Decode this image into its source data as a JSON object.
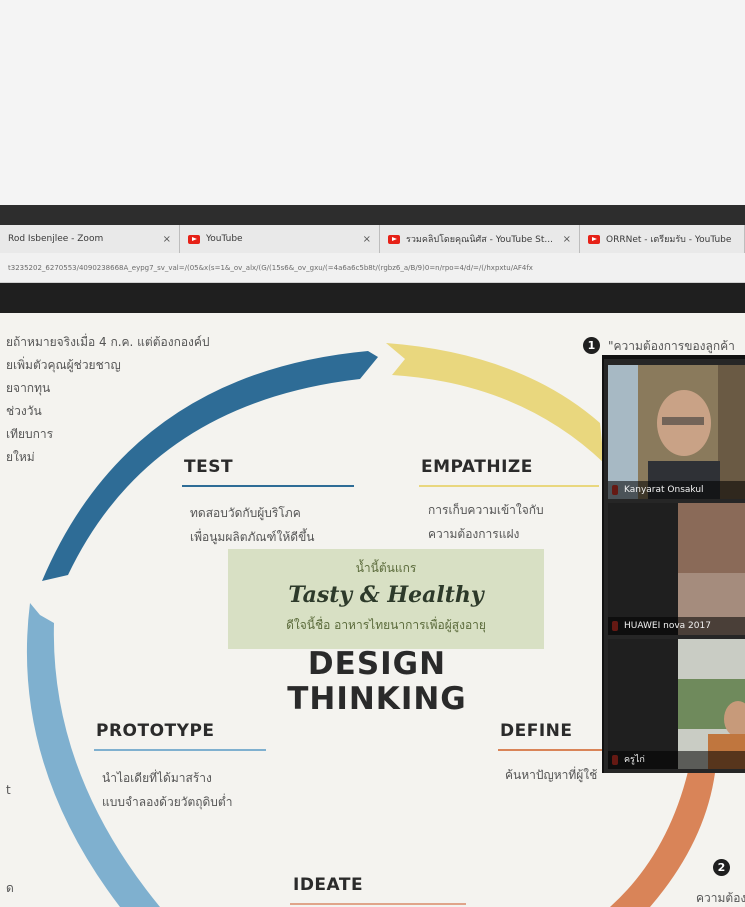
{
  "browser": {
    "tabs": [
      {
        "label": "Rod Isbenjlee - Zoom",
        "icon": "none"
      },
      {
        "label": "YouTube",
        "icon": "youtube-icon"
      },
      {
        "label": "รวมคลิปโดยคุณนิศัส - YouTube St...",
        "icon": "youtube-icon"
      },
      {
        "label": "ORRNet - เตรียมรับ - YouTube",
        "icon": "youtube-icon"
      }
    ],
    "close_glyph": "×",
    "url": "t3235202_6270553/4090238668A_eypg7_sv_val=/(05&x(s=1&_ov_alx/(G/(15s6&_ov_gxu/(=4a6a6c5b8t/(rgbz6_a/B/9)0=n/rpo=4/d/=/(/hxpxtu/AF4fx"
  },
  "slide": {
    "left_text": [
      "ยถ้าหมายจริงเมื่อ 4 ก.ค. แต่ต้องกองค์ป",
      "ยเพิ่มตัวคุณผู้ช่วยชาญ",
      "ยจากทุน",
      "ช่วงวัน",
      "เทียบการ",
      "ยใหม่"
    ],
    "phases": {
      "test": "TEST",
      "empathize": "EMPATHIZE",
      "prototype": "PROTOTYPE",
      "define": "DEFINE",
      "ideate": "IDEATE"
    },
    "test_desc": [
      "ทดสอบวัดกับผู้บริโภค",
      "เพื่อนูมผลิตภัณฑ์ให้ดีขึ้น"
    ],
    "empathize_desc": [
      "การเก็บความเข้าใจกับ",
      "ความต้องการแฝง"
    ],
    "prototype_desc": [
      "นำไอเดียที่ได้มาสร้าง",
      "แบบจำลองด้วยวัตถุดิบต่ำ"
    ],
    "define_desc": "ค้นหาปัญหาที่ผู้ใช้",
    "tasty": {
      "top": "น้ำนี้ต้นแกร",
      "main": "Tasty & Healthy",
      "bottom": "ดีใจนี้ชื่อ อาหารไทยนาการเพื่อผู้สูงอายุ"
    },
    "title_line1": "DESIGN",
    "title_line2": "THINKING",
    "badge1": "1",
    "badge2": "2",
    "note1": "\"ความต้องการของลูกค้า",
    "note2": "ความต้อง",
    "left_edge_1": "t",
    "left_edge_2": "ด"
  },
  "zoom": {
    "participants": [
      {
        "name": "Kanyarat Onsakul"
      },
      {
        "name": "HUAWEI nova 2017"
      },
      {
        "name": "ครูไก่"
      }
    ]
  },
  "colors": {
    "test_arc": "#2e6c96",
    "empathize_arc": "#e9d77e",
    "prototype_arc": "#7fb0cf",
    "define_arc": "#d98458",
    "ideate_line": "#e0a48a"
  }
}
